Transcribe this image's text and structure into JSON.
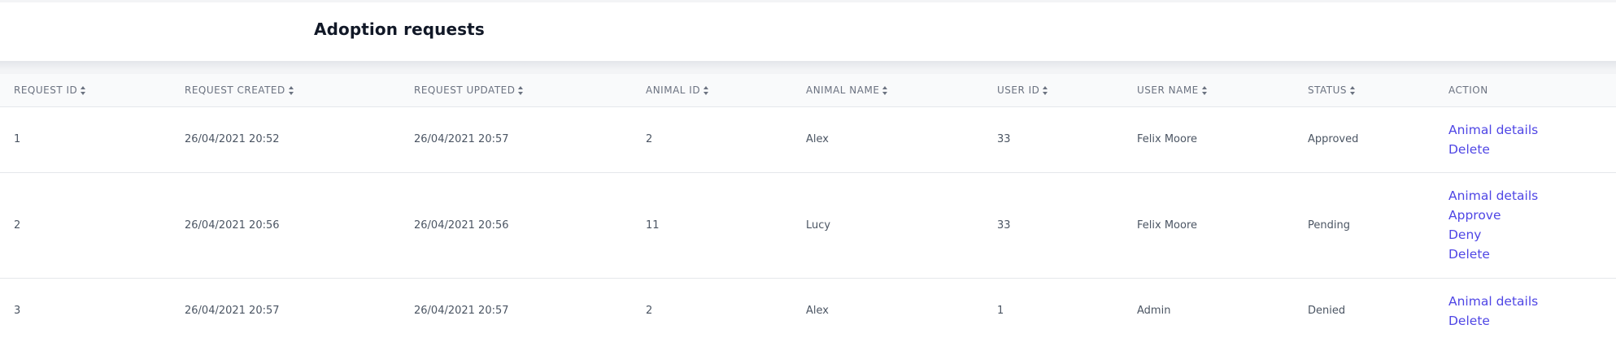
{
  "page": {
    "title": "Adoption requests"
  },
  "table": {
    "columns": [
      {
        "label": "REQUEST ID",
        "sortable": true
      },
      {
        "label": "REQUEST CREATED",
        "sortable": true
      },
      {
        "label": "REQUEST UPDATED",
        "sortable": true
      },
      {
        "label": "ANIMAL ID",
        "sortable": true
      },
      {
        "label": "ANIMAL NAME",
        "sortable": true
      },
      {
        "label": "USER ID",
        "sortable": true
      },
      {
        "label": "USER NAME",
        "sortable": true
      },
      {
        "label": "STATUS",
        "sortable": true
      },
      {
        "label": "ACTION",
        "sortable": false
      }
    ],
    "rows": [
      {
        "request_id": "1",
        "created": "26/04/2021 20:52",
        "updated": "26/04/2021 20:57",
        "animal_id": "2",
        "animal_name": "Alex",
        "user_id": "33",
        "user_name": "Felix Moore",
        "status": "Approved",
        "actions": [
          "Animal details",
          "Delete"
        ]
      },
      {
        "request_id": "2",
        "created": "26/04/2021 20:56",
        "updated": "26/04/2021 20:56",
        "animal_id": "11",
        "animal_name": "Lucy",
        "user_id": "33",
        "user_name": "Felix Moore",
        "status": "Pending",
        "actions": [
          "Animal details",
          "Approve",
          "Deny",
          "Delete"
        ]
      },
      {
        "request_id": "3",
        "created": "26/04/2021 20:57",
        "updated": "26/04/2021 20:57",
        "animal_id": "2",
        "animal_name": "Alex",
        "user_id": "1",
        "user_name": "Admin",
        "status": "Denied",
        "actions": [
          "Animal details",
          "Delete"
        ]
      }
    ]
  },
  "colors": {
    "link": "#4f46e5",
    "header_bg": "#f9fafb",
    "text": "#4b5563",
    "title": "#111827"
  },
  "icons": {
    "sort": "sort-icon"
  }
}
